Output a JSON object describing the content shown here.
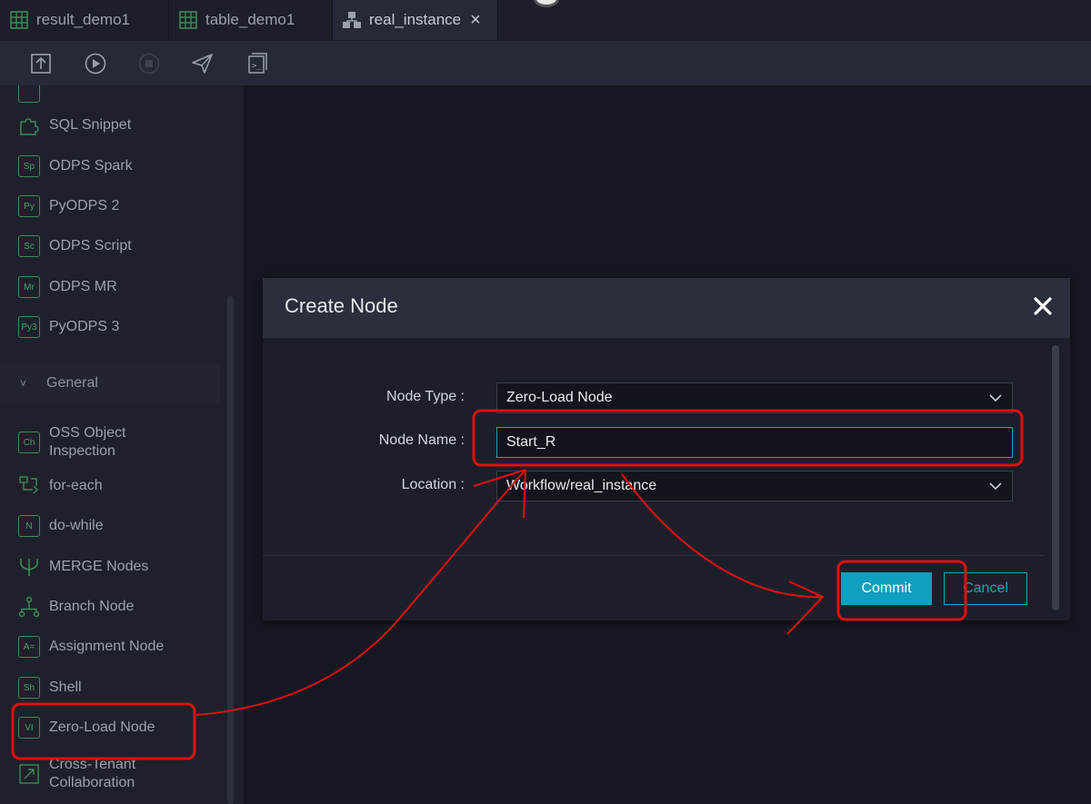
{
  "tabs": [
    {
      "label": "result_demo1",
      "icon": "table-icon"
    },
    {
      "label": "table_demo1",
      "icon": "table-icon"
    },
    {
      "label": "real_instance",
      "icon": "workflow-icon",
      "active": true,
      "close": "×"
    }
  ],
  "toolbar": {
    "buttons": [
      "submit-icon",
      "run-icon",
      "stop-icon",
      "deploy-icon",
      "code-icon"
    ]
  },
  "sidebar": {
    "items": [
      {
        "label": "SQL Snippet",
        "icon": "puzzle-icon"
      },
      {
        "label": "ODPS Spark",
        "badge": "Sp"
      },
      {
        "label": "PyODPS 2",
        "badge": "Py"
      },
      {
        "label": "ODPS Script",
        "badge": "Sc"
      },
      {
        "label": "ODPS MR",
        "badge": "Mr"
      },
      {
        "label": "PyODPS 3",
        "badge": "Py3"
      }
    ],
    "group": {
      "label": "General",
      "chevron": "˅"
    },
    "general_items": [
      {
        "label_line1": "OSS Object",
        "label_line2": "Inspection",
        "badge": "Ch"
      },
      {
        "label": "for-each",
        "icon": "loop-icon"
      },
      {
        "label": "do-while",
        "badge": "N"
      },
      {
        "label": "MERGE Nodes",
        "icon": "merge-icon"
      },
      {
        "label": "Branch Node",
        "icon": "branch-icon"
      },
      {
        "label": "Assignment Node",
        "badge": "A="
      },
      {
        "label": "Shell",
        "badge": "Sh"
      },
      {
        "label": "Zero-Load Node",
        "badge": "VI"
      },
      {
        "label_line1": "Cross-Tenant",
        "label_line2": "Collaboration",
        "icon": "cross-tenant-icon"
      }
    ]
  },
  "dialog": {
    "title": "Create Node",
    "close": "✕",
    "fields": {
      "node_type": {
        "label": "Node Type :",
        "value": "Zero-Load Node"
      },
      "node_name": {
        "label": "Node Name :",
        "value": "Start_R"
      },
      "location": {
        "label": "Location :",
        "value": "Workflow/real_instance"
      }
    },
    "commit_label": "Commit",
    "cancel_label": "Cancel"
  },
  "colors": {
    "accent": "#119ebf",
    "annotation": "#e01010",
    "badge_green": "#4aa067"
  }
}
